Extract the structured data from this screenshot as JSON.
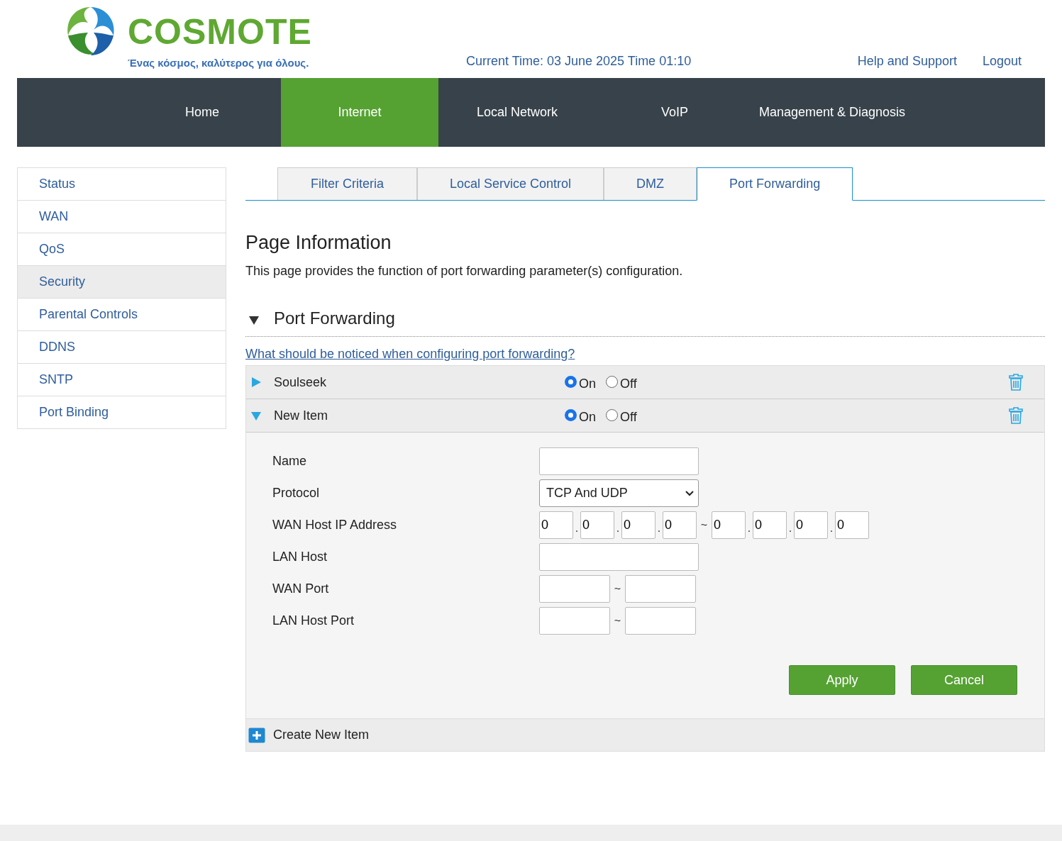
{
  "header": {
    "brand": "COSMOTE",
    "tagline": "Ένας κόσμος, καλύτερος για όλους.",
    "current_time": "Current Time: 03 June 2025 Time 01:10",
    "links": [
      "Help and Support",
      "Logout"
    ]
  },
  "nav": [
    {
      "label": "Home",
      "selected": false
    },
    {
      "label": "Internet",
      "selected": true
    },
    {
      "label": "Local Network",
      "selected": false
    },
    {
      "label": "VoIP",
      "selected": false
    },
    {
      "label": "Management & Diagnosis",
      "selected": false
    }
  ],
  "sidebar": [
    {
      "label": "Status",
      "selected": false
    },
    {
      "label": "WAN",
      "selected": false
    },
    {
      "label": "QoS",
      "selected": false
    },
    {
      "label": "Security",
      "selected": true
    },
    {
      "label": "Parental Controls",
      "selected": false
    },
    {
      "label": "DDNS",
      "selected": false
    },
    {
      "label": "SNTP",
      "selected": false
    },
    {
      "label": "Port Binding",
      "selected": false
    }
  ],
  "tabs": [
    {
      "label": "Filter Criteria",
      "selected": false
    },
    {
      "label": "Local Service Control",
      "selected": false
    },
    {
      "label": "DMZ",
      "selected": false
    },
    {
      "label": "Port Forwarding",
      "selected": true
    }
  ],
  "page_info": {
    "title": "Page Information",
    "description": "This page provides the function of port forwarding parameter(s) configuration."
  },
  "section": {
    "title": "Port Forwarding",
    "expanded": true,
    "help_link": "What should be noticed when configuring port forwarding?"
  },
  "rules": [
    {
      "name": "Soulseek",
      "expanded": false,
      "options": [
        {
          "label": "On",
          "selected": true
        },
        {
          "label": "Off",
          "selected": false
        }
      ]
    },
    {
      "name": "New Item",
      "expanded": true,
      "options": [
        {
          "label": "On",
          "selected": true
        },
        {
          "label": "Off",
          "selected": false
        }
      ]
    }
  ],
  "form": {
    "fields": [
      {
        "kind": "text",
        "label": "Name"
      },
      {
        "kind": "select",
        "label": "Protocol",
        "value": "TCP And UDP"
      },
      {
        "kind": "ip_range",
        "label": "WAN Host IP Address",
        "start": [
          "0",
          "0",
          "0",
          "0"
        ],
        "end": [
          "0",
          "0",
          "0",
          "0"
        ],
        "dot": ".",
        "separator": "~"
      },
      {
        "kind": "text",
        "label": "LAN Host"
      },
      {
        "kind": "port_range",
        "label": "WAN Port",
        "separator": "~"
      },
      {
        "kind": "port_range",
        "label": "LAN Host Port",
        "separator": "~"
      }
    ],
    "buttons": [
      "Apply",
      "Cancel"
    ]
  },
  "create_new_item": "Create New Item"
}
